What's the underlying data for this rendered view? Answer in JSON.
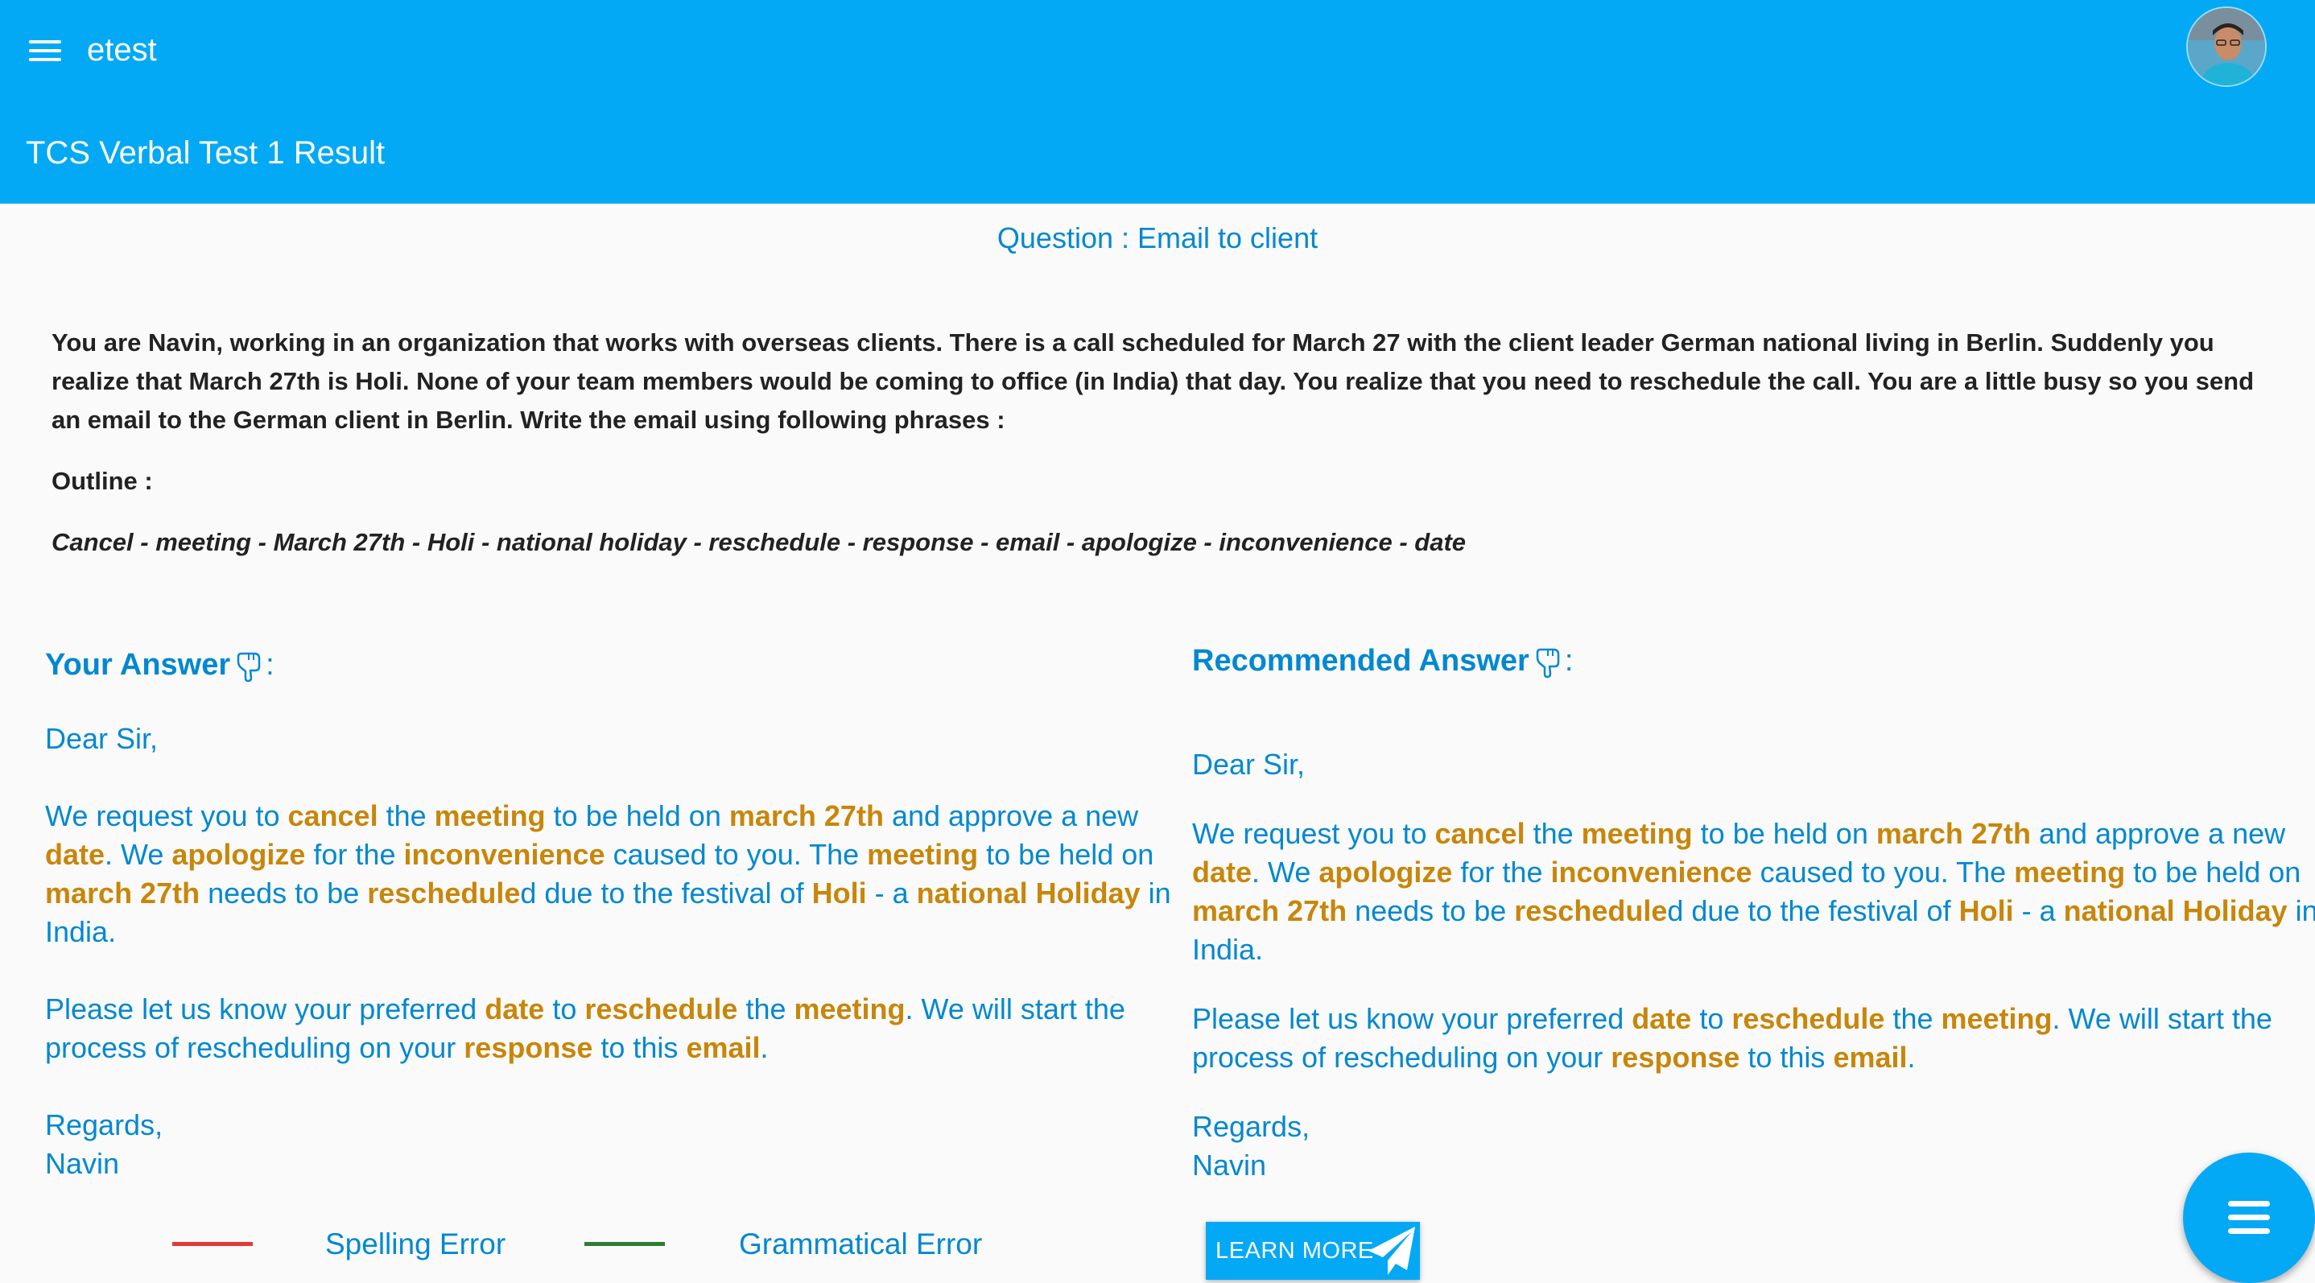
{
  "header": {
    "app_title": "etest",
    "page_title": "TCS Verbal Test 1 Result",
    "menu_icon": "hamburger-icon",
    "avatar_icon": "user-avatar"
  },
  "question": {
    "title": "Question : Email to client",
    "text": "You are Navin, working in an organization that works with overseas clients. There is a call scheduled for March 27 with the client leader German national living in Berlin. Suddenly you realize that March 27th is Holi. None of your team members would be coming to office (in India) that day. You realize that you need to reschedule the call. You are a little busy so you send an email to the German client in Berlin. Write the email using following phrases :",
    "outline_label": "Outline :",
    "outline_text": "Cancel - meeting - March 27th - Holi - national holiday - reschedule - response - email - apologize - inconvenience - date"
  },
  "your_answer": {
    "heading": "Your Answer",
    "colon": ":",
    "icon": "pointing-hand-icon"
  },
  "recommended_answer": {
    "heading": "Recommended Answer",
    "colon": ":",
    "icon": "pointing-hand-icon"
  },
  "email": {
    "greeting": "Dear Sir,",
    "para1": [
      {
        "t": "We request you to ",
        "k": false
      },
      {
        "t": "cancel",
        "k": true
      },
      {
        "t": " the ",
        "k": false
      },
      {
        "t": "meeting",
        "k": true
      },
      {
        "t": " to be held on ",
        "k": false
      },
      {
        "t": "march 27th",
        "k": true
      },
      {
        "t": " and approve a new ",
        "k": false
      },
      {
        "t": "date",
        "k": true
      },
      {
        "t": ". We ",
        "k": false
      },
      {
        "t": "apologize",
        "k": true
      },
      {
        "t": " for the ",
        "k": false
      },
      {
        "t": "inconvenience",
        "k": true
      },
      {
        "t": " caused to you. The ",
        "k": false
      },
      {
        "t": "meeting",
        "k": true
      },
      {
        "t": " to be held on ",
        "k": false
      },
      {
        "t": "march 27th",
        "k": true
      },
      {
        "t": " needs to be ",
        "k": false
      },
      {
        "t": "reschedule",
        "k": true
      },
      {
        "t": "d due to the festival of ",
        "k": false
      },
      {
        "t": "Holi",
        "k": true
      },
      {
        "t": " - a ",
        "k": false
      },
      {
        "t": "national Holiday",
        "k": true
      },
      {
        "t": " in India.",
        "k": false
      }
    ],
    "para2": [
      {
        "t": "Please let us know your preferred ",
        "k": false
      },
      {
        "t": "date",
        "k": true
      },
      {
        "t": " to ",
        "k": false
      },
      {
        "t": "reschedule",
        "k": true
      },
      {
        "t": " the ",
        "k": false
      },
      {
        "t": "meeting",
        "k": true
      },
      {
        "t": ". We will start the process of rescheduling on your ",
        "k": false
      },
      {
        "t": "response",
        "k": true
      },
      {
        "t": " to this ",
        "k": false
      },
      {
        "t": "email",
        "k": true
      },
      {
        "t": ".",
        "k": false
      }
    ],
    "closing": "Regards,",
    "signature": "Navin"
  },
  "legend": {
    "spelling_label": "Spelling Error",
    "spelling_color": "#e53935",
    "grammar_label": "Grammatical Error",
    "grammar_color": "#2e7d32"
  },
  "learn_more": {
    "label": "LEARN MORE",
    "icon": "paper-plane-icon"
  },
  "fab": {
    "icon": "menu-icon"
  },
  "colors": {
    "primary": "#03a9f4",
    "text_blue": "#0288d1",
    "keyword": "#c8860a"
  }
}
